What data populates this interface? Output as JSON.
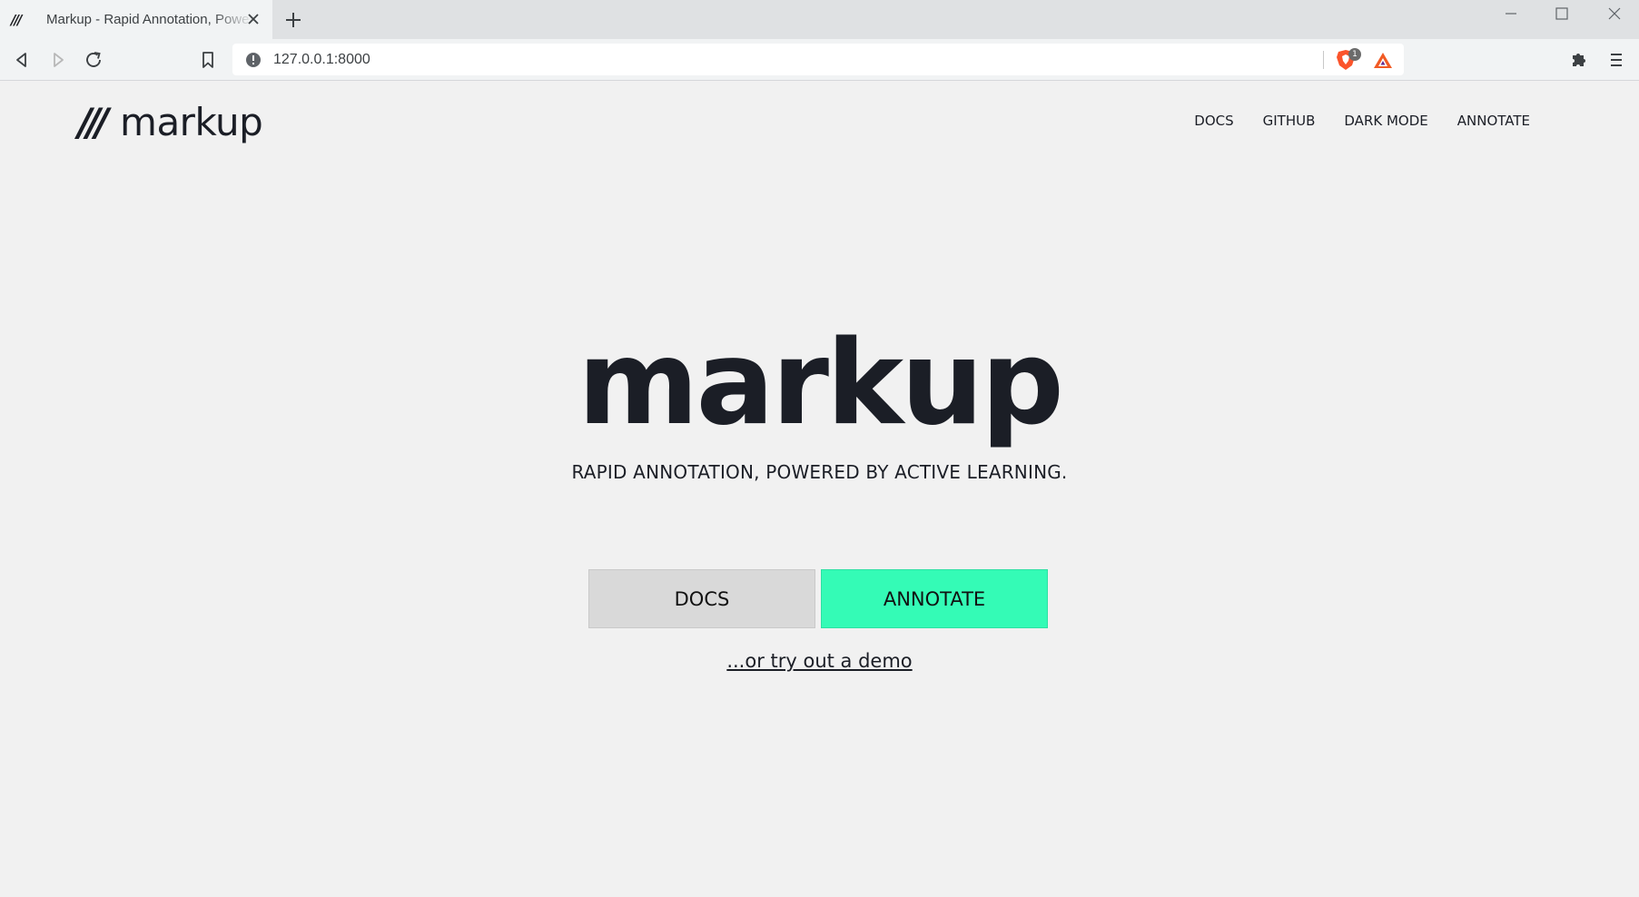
{
  "browser": {
    "tab_title": "Markup - Rapid Annotation, Powered by Active Learning",
    "tab_favicon": "///",
    "url": "127.0.0.1:8000",
    "shields_count": "1"
  },
  "header": {
    "logo_slashes": "///",
    "logo_text": "markup",
    "nav": [
      "DOCS",
      "GITHUB",
      "DARK MODE",
      "ANNOTATE"
    ]
  },
  "hero": {
    "title": "markup",
    "subtitle": "RAPID ANNOTATION, POWERED BY ACTIVE LEARNING.",
    "docs_button": "DOCS",
    "annotate_button": "ANNOTATE",
    "demo_link": "...or try out a demo"
  },
  "colors": {
    "accent": "#34fbb6",
    "page_bg": "#f1f1f1",
    "text": "#1b1e26",
    "docs_button_bg": "#d9d9d9"
  }
}
